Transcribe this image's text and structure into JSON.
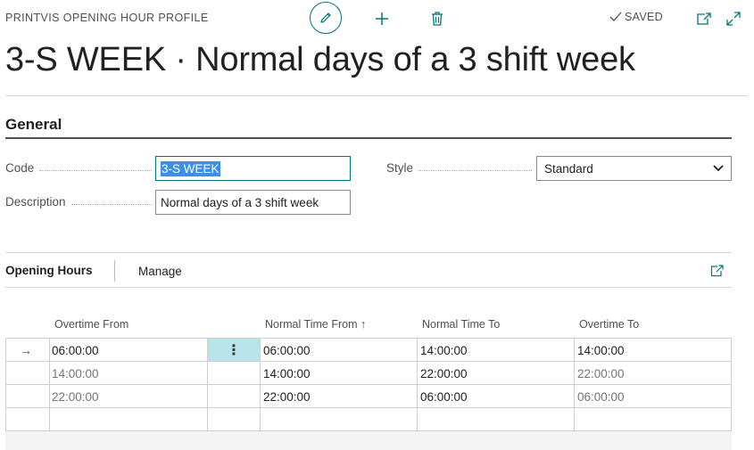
{
  "header": {
    "page_kind": "PRINTVIS OPENING HOUR PROFILE",
    "status": "SAVED",
    "title": "3-S WEEK · Normal days of a 3 shift week",
    "icons": {
      "edit": "pencil-icon",
      "add": "plus-icon",
      "delete": "trash-icon",
      "saved": "checkmark-icon",
      "popout": "popout-icon",
      "expand": "expand-icon"
    }
  },
  "general": {
    "title": "General",
    "code_label": "Code",
    "code_value": "3-S WEEK",
    "description_label": "Description",
    "description_value": "Normal days of a 3 shift week",
    "style_label": "Style",
    "style_value": "Standard"
  },
  "opening_hours": {
    "tab_active": "Opening Hours",
    "tab_manage": "Manage",
    "columns": [
      "Overtime From",
      "Normal Time From ↑",
      "Normal Time To",
      "Overtime To"
    ],
    "rows": [
      {
        "overtime_from": "06:00:00",
        "normal_from": "06:00:00",
        "normal_to": "14:00:00",
        "overtime_to": "14:00:00"
      },
      {
        "overtime_from": "14:00:00",
        "normal_from": "14:00:00",
        "normal_to": "22:00:00",
        "overtime_to": "22:00:00"
      },
      {
        "overtime_from": "22:00:00",
        "normal_from": "22:00:00",
        "normal_to": "06:00:00",
        "overtime_to": "06:00:00"
      }
    ],
    "current_row_marker": "→",
    "row_menu": "⋮"
  },
  "colors": {
    "accent": "#00777a",
    "selection": "#3b8eea",
    "active_cell": "#b8e5ea"
  }
}
